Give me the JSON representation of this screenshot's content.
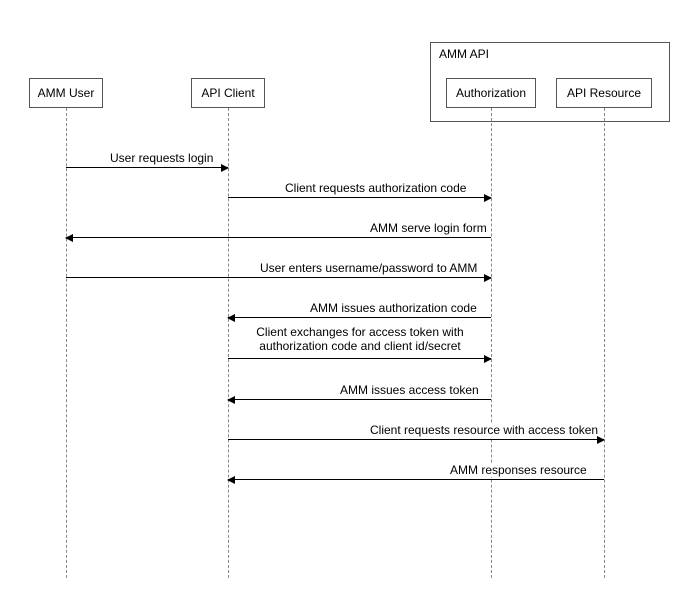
{
  "participants": {
    "user": "AMM User",
    "client": "API Client",
    "api_frame": "AMM API",
    "auth": "Authorization",
    "resource": "API Resource"
  },
  "messages": {
    "m1": "User requests login",
    "m2": "Client requests authorization code",
    "m3": "AMM serve login form",
    "m4": "User enters username/password to AMM",
    "m5": "AMM issues authorization code",
    "m6": "Client exchanges for access token with authorization code and client id/secret",
    "m7": "AMM issues access token",
    "m8": "Client requests resource with access token",
    "m9": "AMM responses resource"
  },
  "chart_data": {
    "type": "sequence-diagram",
    "participants": [
      "AMM User",
      "API Client",
      "Authorization",
      "API Resource"
    ],
    "group": {
      "name": "AMM API",
      "members": [
        "Authorization",
        "API Resource"
      ]
    },
    "steps": [
      {
        "from": "AMM User",
        "to": "API Client",
        "label": "User requests login"
      },
      {
        "from": "API Client",
        "to": "Authorization",
        "label": "Client requests authorization code"
      },
      {
        "from": "Authorization",
        "to": "AMM User",
        "label": "AMM serve login form"
      },
      {
        "from": "AMM User",
        "to": "Authorization",
        "label": "User enters username/password to AMM"
      },
      {
        "from": "Authorization",
        "to": "API Client",
        "label": "AMM issues authorization code"
      },
      {
        "from": "API Client",
        "to": "Authorization",
        "label": "Client exchanges for access token with authorization code and client id/secret"
      },
      {
        "from": "Authorization",
        "to": "API Client",
        "label": "AMM issues access token"
      },
      {
        "from": "API Client",
        "to": "API Resource",
        "label": "Client requests resource with access token"
      },
      {
        "from": "API Resource",
        "to": "API Client",
        "label": "AMM responses resource"
      }
    ]
  }
}
